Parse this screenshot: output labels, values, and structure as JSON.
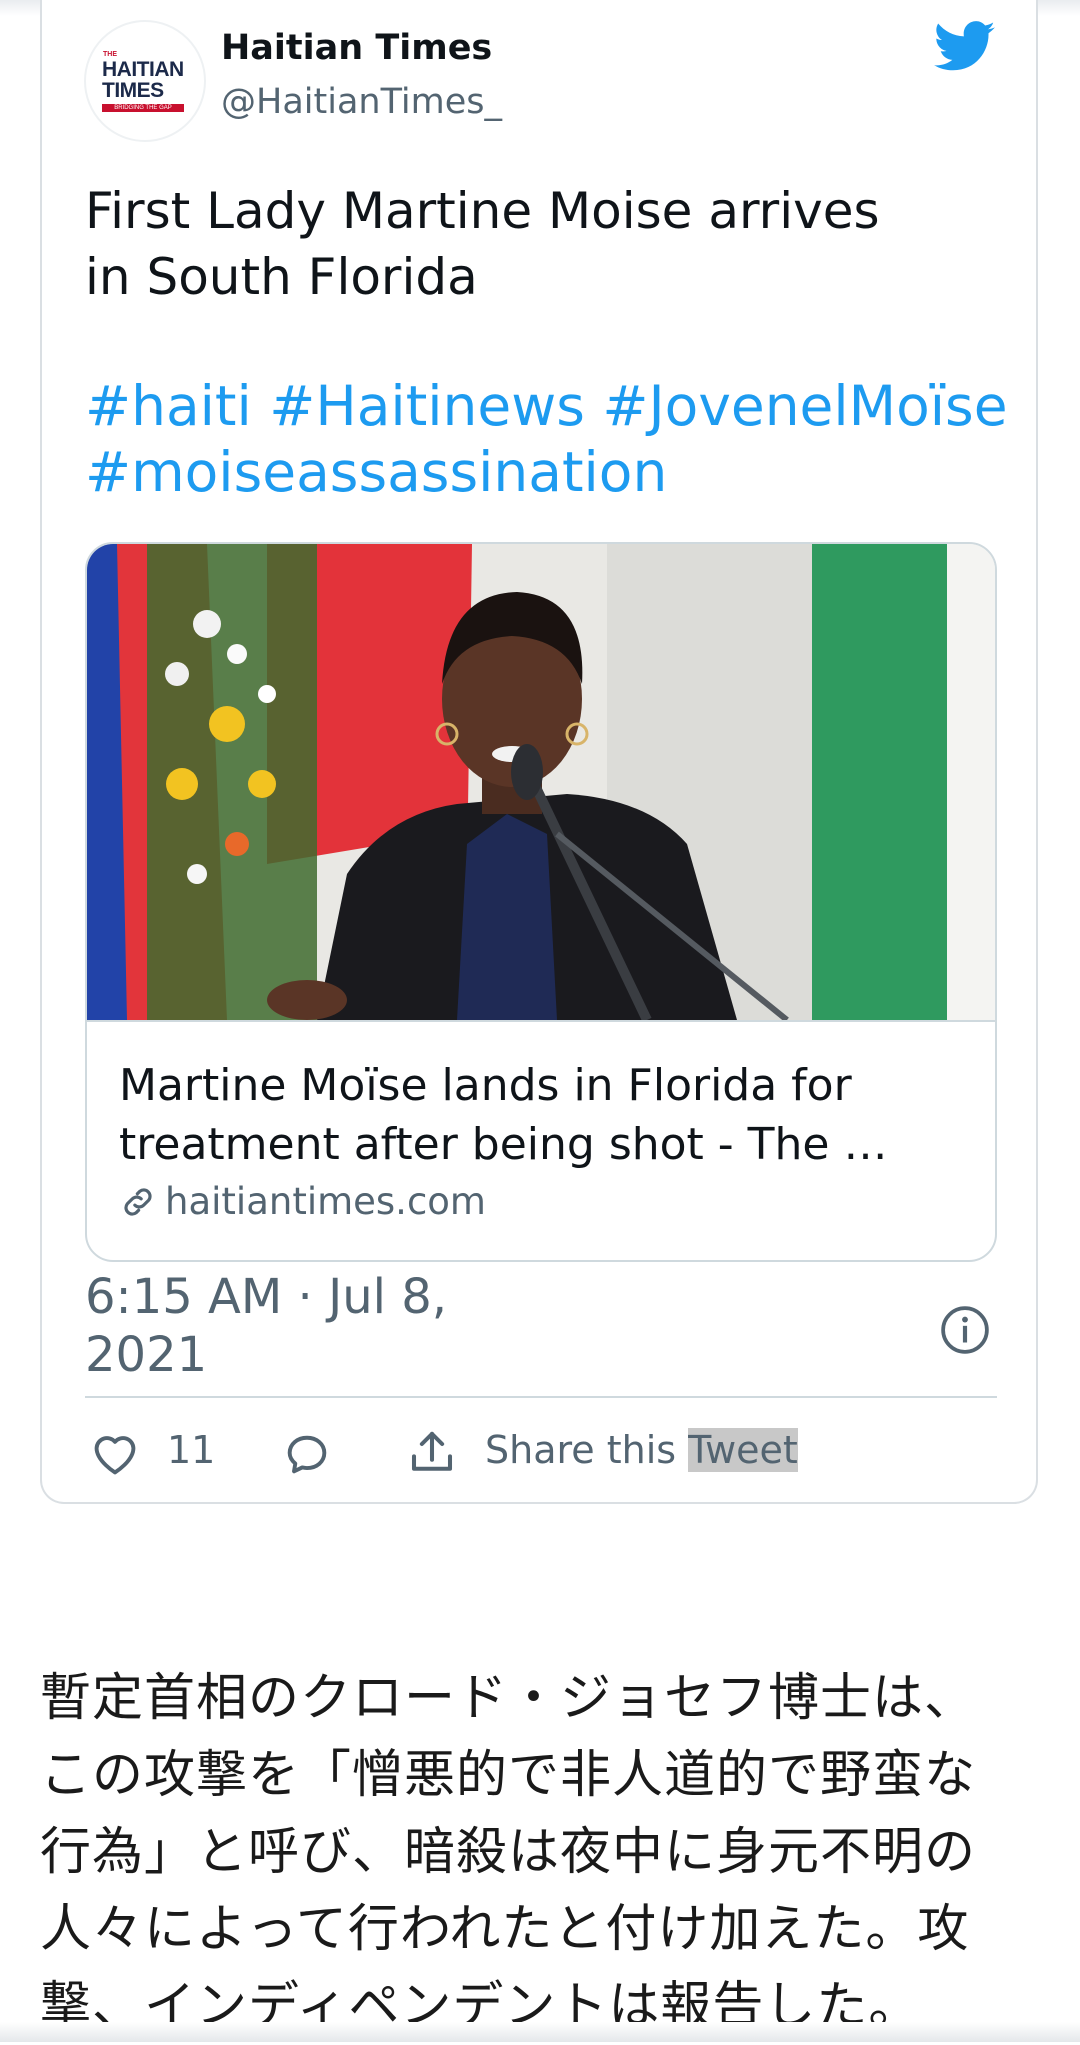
{
  "tweet": {
    "avatar": {
      "logo_small": "THE",
      "logo_line1": "HAITIAN",
      "logo_line2": "TIMES",
      "logo_tagline": "BRIDGING THE GAP"
    },
    "author_name": "Haitian Times",
    "author_handle": "@HaitianTimes_",
    "text_lines": [
      "First Lady Martine Moise arrives",
      "in South Florida"
    ],
    "hashtags": [
      "#haiti",
      "#Haitinews",
      "#JovenelMoïse",
      "#moiseassassination"
    ],
    "link_card": {
      "title_lines": [
        "Martine Moïse lands in Florida for",
        "treatment after being shot - The …"
      ],
      "domain": "haitiantimes.com"
    },
    "timestamp_lines": [
      "6:15 AM · Jul 8,",
      "2021"
    ],
    "actions": {
      "like_count": "11",
      "share_label_a": "Share this ",
      "share_label_b": "Tweet"
    },
    "colors": {
      "link_blue": "#1d9bf0",
      "secondary_text": "#536471",
      "twitter_blue": "#1d9bf0"
    }
  },
  "article": {
    "lines": [
      "暫定首相のクロード・ジョセフ博士は、",
      "この攻撃を「憎悪的で非人道的で野蛮な",
      "行為」と呼び、暗殺は夜中に身元不明の",
      "人々によって行われたと付け加えた。攻",
      "撃、インディペンデントは報告した。"
    ]
  }
}
